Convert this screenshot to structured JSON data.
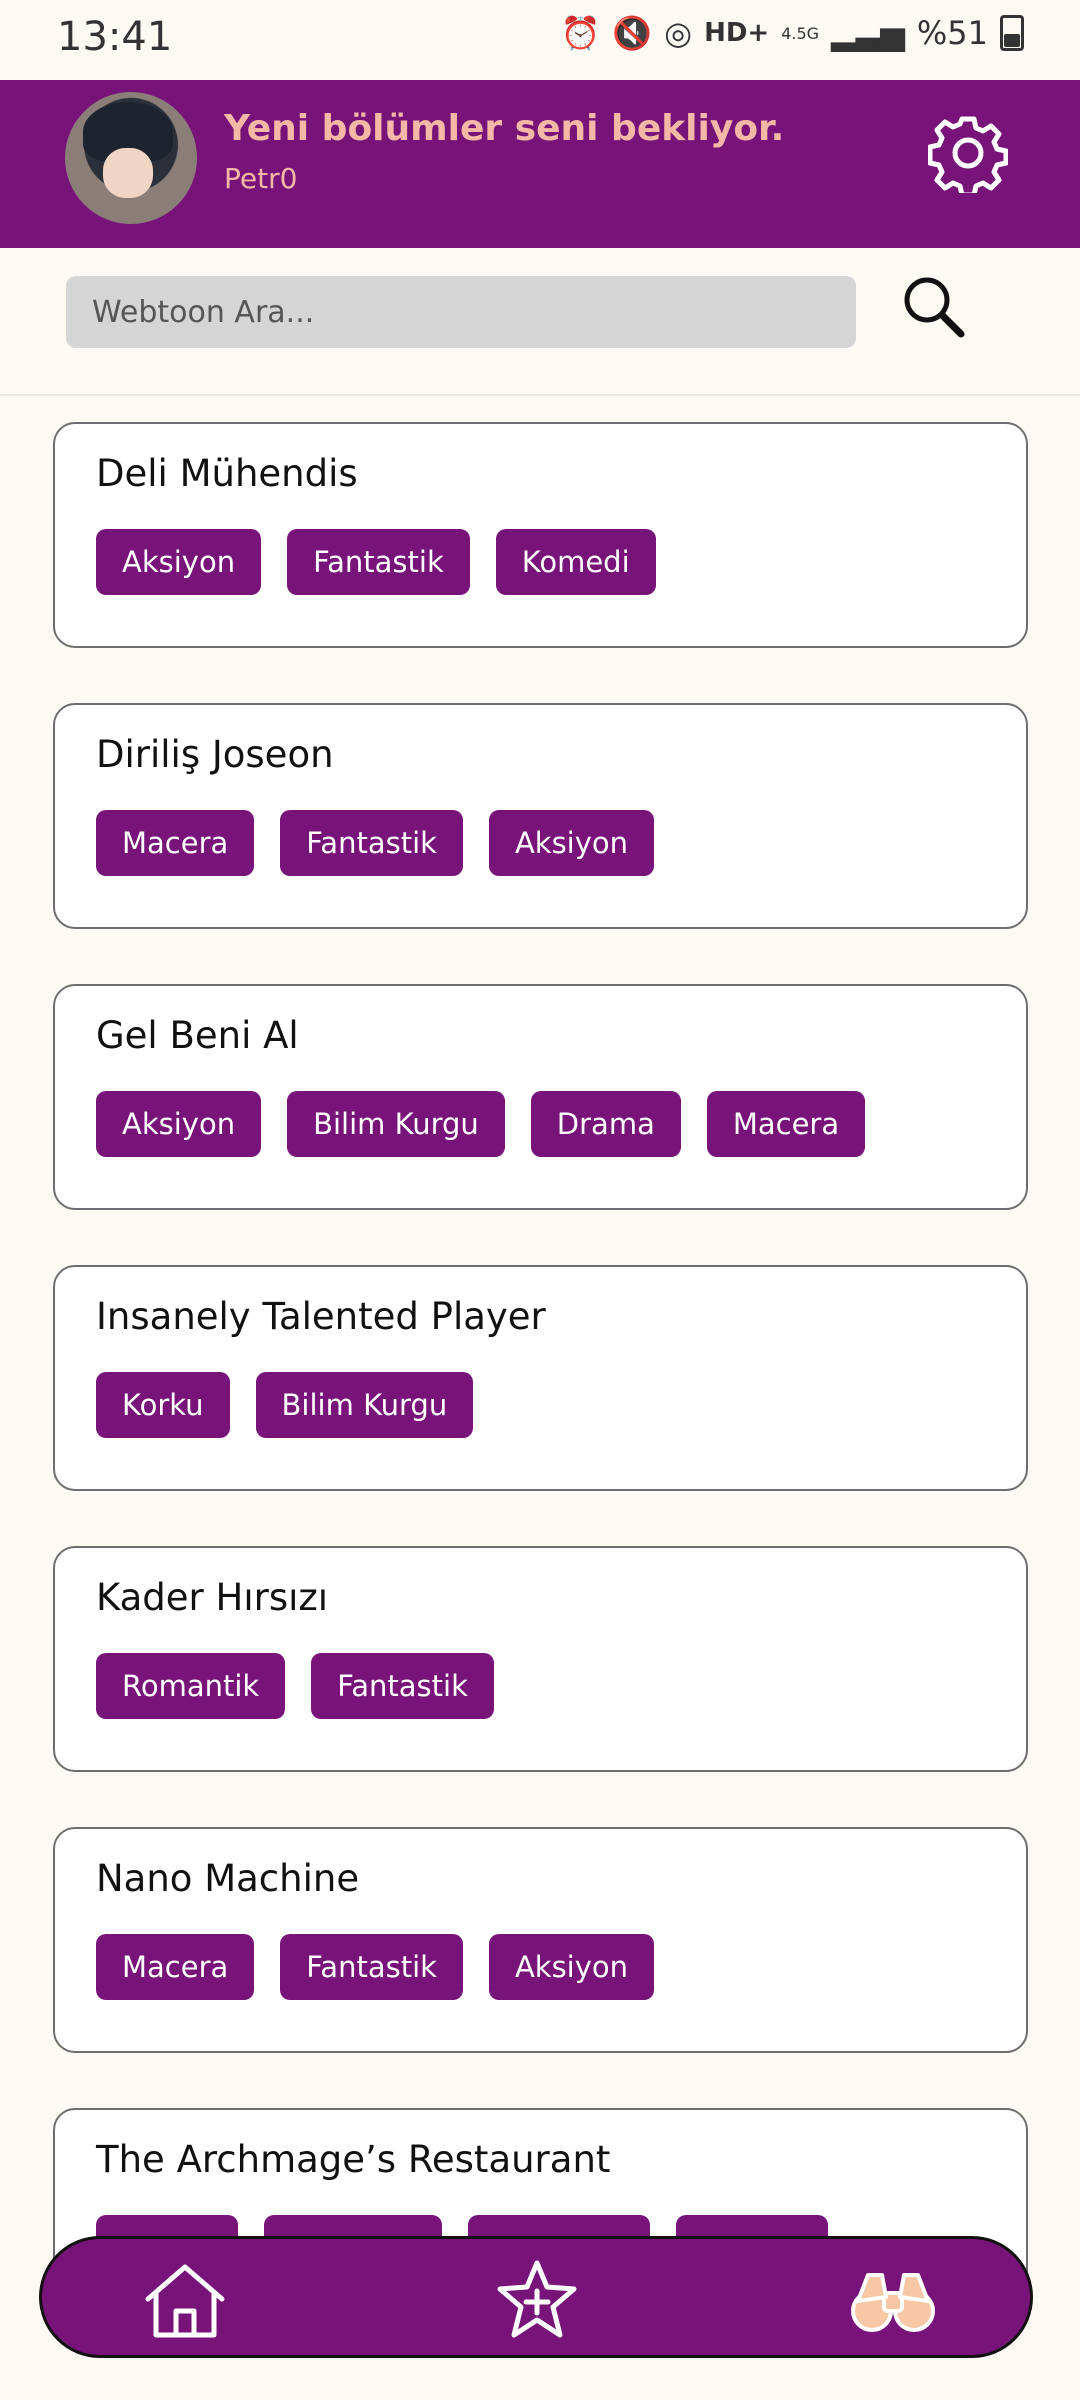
{
  "status_bar": {
    "time": "13:41",
    "network": "4.5G",
    "battery": "%51"
  },
  "header": {
    "title": "Yeni bölümler seni bekliyor.",
    "username": "Petr0"
  },
  "search": {
    "placeholder": "Webtoon Ara..."
  },
  "webtoons": [
    {
      "title": "Deli Mühendis",
      "genres": [
        "Aksiyon",
        "Fantastik",
        "Komedi"
      ]
    },
    {
      "title": "Diriliş Joseon",
      "genres": [
        "Macera",
        "Fantastik",
        "Aksiyon"
      ]
    },
    {
      "title": "Gel Beni Al",
      "genres": [
        "Aksiyon",
        "Bilim Kurgu",
        "Drama",
        "Macera"
      ]
    },
    {
      "title": "Insanely Talented Player",
      "genres": [
        "Korku",
        "Bilim Kurgu"
      ]
    },
    {
      "title": "Kader Hırsızı",
      "genres": [
        "Romantik",
        "Fantastik"
      ]
    },
    {
      "title": "Nano Machine",
      "genres": [
        "Macera",
        "Fantastik",
        "Aksiyon"
      ]
    },
    {
      "title": "The Archmage’s Restaurant",
      "genres": [
        "",
        "",
        "",
        ""
      ]
    }
  ],
  "colors": {
    "brand": "#781479",
    "accent": "#f5b7a6",
    "background": "#fdfaf4"
  },
  "nav": {
    "items": [
      "home-icon",
      "star-plus-icon",
      "binoculars-icon"
    ]
  }
}
